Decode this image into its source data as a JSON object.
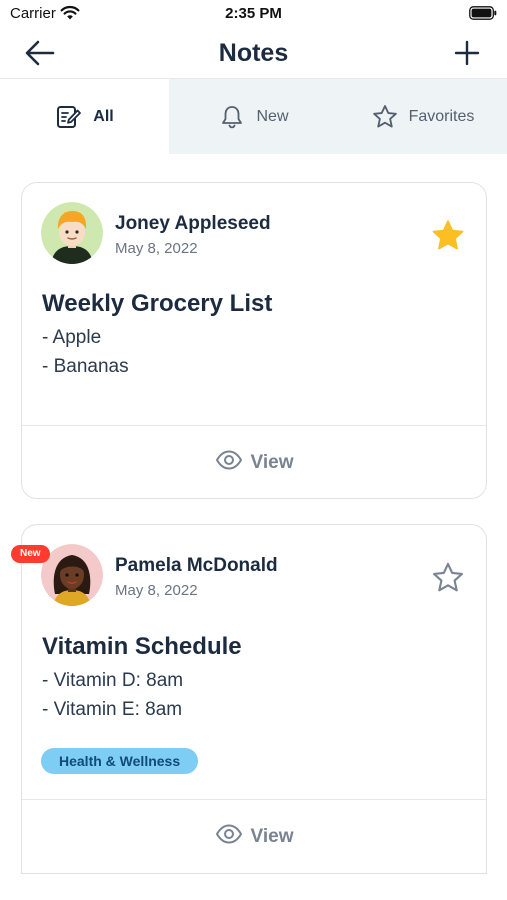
{
  "status_bar": {
    "carrier": "Carrier",
    "time": "2:35 PM"
  },
  "header": {
    "title": "Notes"
  },
  "tabs": [
    {
      "label": "All",
      "icon": "edit-note-icon",
      "active": true
    },
    {
      "label": "New",
      "icon": "bell-icon",
      "active": false
    },
    {
      "label": "Favorites",
      "icon": "star-outline-icon",
      "active": false
    }
  ],
  "notes": [
    {
      "author": "Joney Appleseed",
      "date": "May 8, 2022",
      "favorite": true,
      "title": "Weekly Grocery List",
      "lines": [
        "- Apple",
        "- Bananas"
      ],
      "view_label": "View"
    },
    {
      "author": "Pamela McDonald",
      "date": "May 8, 2022",
      "favorite": false,
      "badge": "New",
      "title": "Vitamin Schedule",
      "lines": [
        "- Vitamin D: 8am",
        "- Vitamin E: 8am"
      ],
      "tag": "Health & Wellness",
      "view_label": "View"
    }
  ],
  "colors": {
    "star_active": "#fbbf24",
    "tag_bg": "#7dcdf5",
    "badge": "#ff3b30",
    "tab_inactive_bg": "#eef3f6"
  }
}
